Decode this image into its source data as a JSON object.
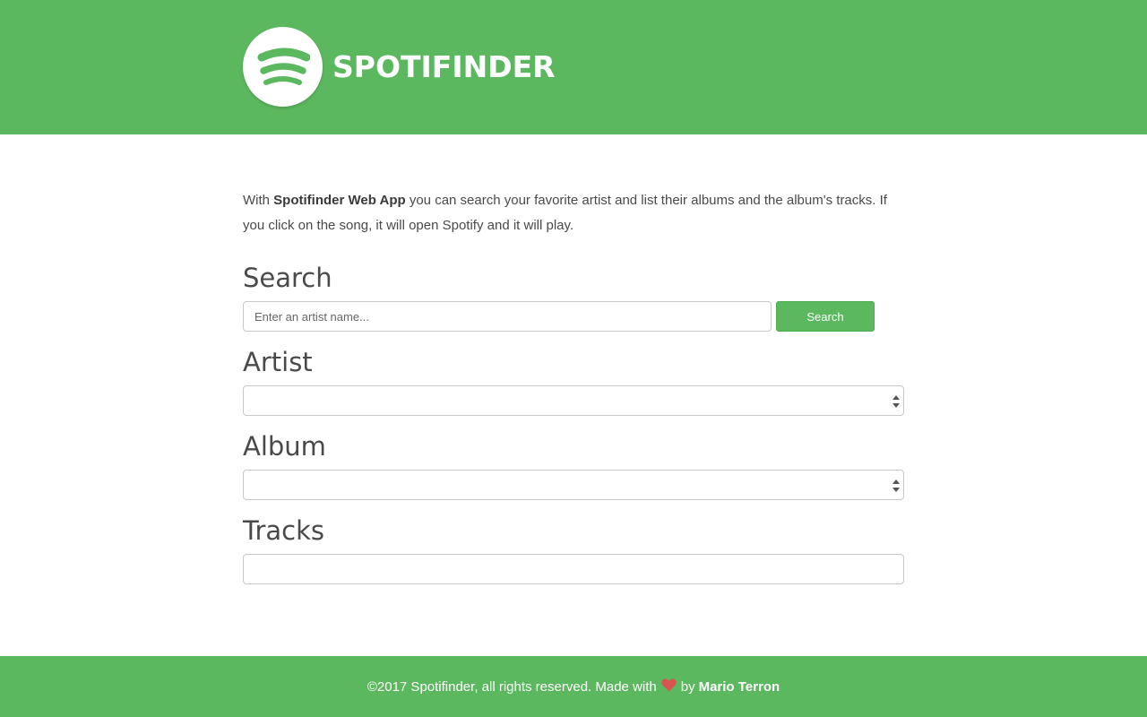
{
  "header": {
    "brand": "SPOTIFINDER",
    "logo_icon": "spotify-logo-icon",
    "brand_color": "#5cb85f"
  },
  "intro": {
    "prefix": "With ",
    "app_name": "Spotifinder Web App",
    "text": " you can search your favorite artist and list their albums and the album's tracks. If you click on the song, it will open Spotify and it will play."
  },
  "search": {
    "title": "Search",
    "placeholder": "Enter an artist name...",
    "value": "",
    "button_label": "Search"
  },
  "artist": {
    "title": "Artist",
    "selected": ""
  },
  "album": {
    "title": "Album",
    "selected": ""
  },
  "tracks": {
    "title": "Tracks"
  },
  "footer": {
    "text_before": "©2017 Spotifinder, all rights reserved. Made with",
    "heart_icon": "heart-icon",
    "heart_color": "#d9534f",
    "by": "by",
    "author": "Mario Terron"
  }
}
